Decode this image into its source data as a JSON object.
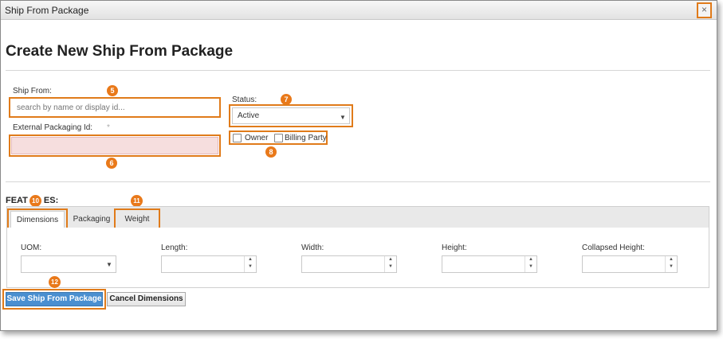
{
  "window": {
    "title": "Ship From Package",
    "close_glyph": "×"
  },
  "page": {
    "heading": "Create New Ship From Package"
  },
  "form": {
    "ship_from": {
      "label": "Ship From:",
      "placeholder": "search by name or display id..."
    },
    "external_id": {
      "label": "External Packaging Id:",
      "required_marker": "*"
    },
    "status": {
      "label": "Status:",
      "value": "Active"
    },
    "owner_label": "Owner",
    "billing_party_label": "Billing Party"
  },
  "features": {
    "heading_visible": "FEAT",
    "heading_tail": "ES:",
    "tabs": [
      {
        "label": "Dimensions",
        "active": true
      },
      {
        "label": "Packaging",
        "active": false
      },
      {
        "label": "Weight",
        "active": false
      }
    ],
    "dimensions": {
      "uom_label": "UOM:",
      "length_label": "Length:",
      "width_label": "Width:",
      "height_label": "Height:",
      "collapsed_height_label": "Collapsed Height:"
    }
  },
  "buttons": {
    "save": "Save Ship From Package",
    "cancel": "Cancel Dimensions"
  },
  "callouts": [
    "5",
    "6",
    "7",
    "8",
    "10",
    "11",
    "12"
  ],
  "colors": {
    "callout": "#e9791a",
    "primary_button": "#4a8fd0",
    "highlight_border": "#e07b1a"
  }
}
